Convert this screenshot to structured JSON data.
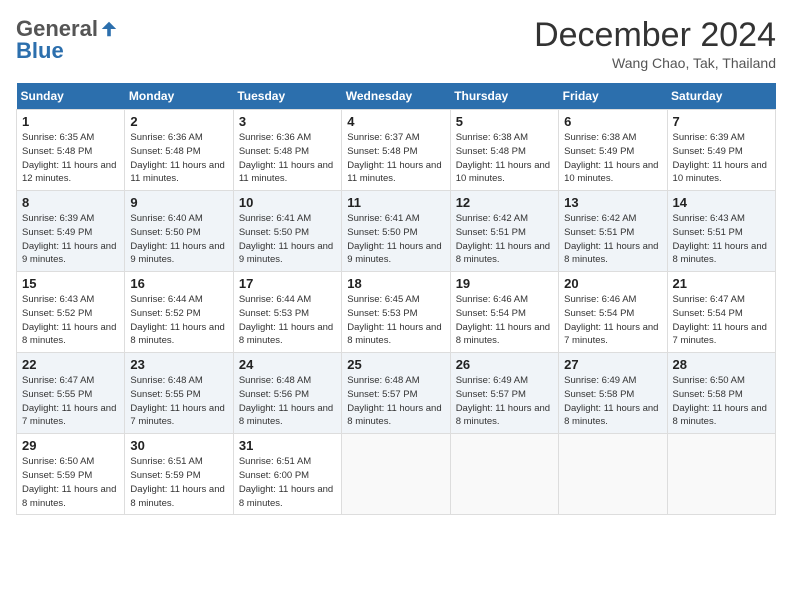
{
  "logo": {
    "general": "General",
    "blue": "Blue"
  },
  "title": "December 2024",
  "location": "Wang Chao, Tak, Thailand",
  "days_of_week": [
    "Sunday",
    "Monday",
    "Tuesday",
    "Wednesday",
    "Thursday",
    "Friday",
    "Saturday"
  ],
  "weeks": [
    [
      {
        "day": 1,
        "sunrise": "6:35 AM",
        "sunset": "5:48 PM",
        "daylight": "11 hours and 12 minutes."
      },
      {
        "day": 2,
        "sunrise": "6:36 AM",
        "sunset": "5:48 PM",
        "daylight": "11 hours and 11 minutes."
      },
      {
        "day": 3,
        "sunrise": "6:36 AM",
        "sunset": "5:48 PM",
        "daylight": "11 hours and 11 minutes."
      },
      {
        "day": 4,
        "sunrise": "6:37 AM",
        "sunset": "5:48 PM",
        "daylight": "11 hours and 11 minutes."
      },
      {
        "day": 5,
        "sunrise": "6:38 AM",
        "sunset": "5:48 PM",
        "daylight": "11 hours and 10 minutes."
      },
      {
        "day": 6,
        "sunrise": "6:38 AM",
        "sunset": "5:49 PM",
        "daylight": "11 hours and 10 minutes."
      },
      {
        "day": 7,
        "sunrise": "6:39 AM",
        "sunset": "5:49 PM",
        "daylight": "11 hours and 10 minutes."
      }
    ],
    [
      {
        "day": 8,
        "sunrise": "6:39 AM",
        "sunset": "5:49 PM",
        "daylight": "11 hours and 9 minutes."
      },
      {
        "day": 9,
        "sunrise": "6:40 AM",
        "sunset": "5:50 PM",
        "daylight": "11 hours and 9 minutes."
      },
      {
        "day": 10,
        "sunrise": "6:41 AM",
        "sunset": "5:50 PM",
        "daylight": "11 hours and 9 minutes."
      },
      {
        "day": 11,
        "sunrise": "6:41 AM",
        "sunset": "5:50 PM",
        "daylight": "11 hours and 9 minutes."
      },
      {
        "day": 12,
        "sunrise": "6:42 AM",
        "sunset": "5:51 PM",
        "daylight": "11 hours and 8 minutes."
      },
      {
        "day": 13,
        "sunrise": "6:42 AM",
        "sunset": "5:51 PM",
        "daylight": "11 hours and 8 minutes."
      },
      {
        "day": 14,
        "sunrise": "6:43 AM",
        "sunset": "5:51 PM",
        "daylight": "11 hours and 8 minutes."
      }
    ],
    [
      {
        "day": 15,
        "sunrise": "6:43 AM",
        "sunset": "5:52 PM",
        "daylight": "11 hours and 8 minutes."
      },
      {
        "day": 16,
        "sunrise": "6:44 AM",
        "sunset": "5:52 PM",
        "daylight": "11 hours and 8 minutes."
      },
      {
        "day": 17,
        "sunrise": "6:44 AM",
        "sunset": "5:53 PM",
        "daylight": "11 hours and 8 minutes."
      },
      {
        "day": 18,
        "sunrise": "6:45 AM",
        "sunset": "5:53 PM",
        "daylight": "11 hours and 8 minutes."
      },
      {
        "day": 19,
        "sunrise": "6:46 AM",
        "sunset": "5:54 PM",
        "daylight": "11 hours and 8 minutes."
      },
      {
        "day": 20,
        "sunrise": "6:46 AM",
        "sunset": "5:54 PM",
        "daylight": "11 hours and 7 minutes."
      },
      {
        "day": 21,
        "sunrise": "6:47 AM",
        "sunset": "5:54 PM",
        "daylight": "11 hours and 7 minutes."
      }
    ],
    [
      {
        "day": 22,
        "sunrise": "6:47 AM",
        "sunset": "5:55 PM",
        "daylight": "11 hours and 7 minutes."
      },
      {
        "day": 23,
        "sunrise": "6:48 AM",
        "sunset": "5:55 PM",
        "daylight": "11 hours and 7 minutes."
      },
      {
        "day": 24,
        "sunrise": "6:48 AM",
        "sunset": "5:56 PM",
        "daylight": "11 hours and 8 minutes."
      },
      {
        "day": 25,
        "sunrise": "6:48 AM",
        "sunset": "5:57 PM",
        "daylight": "11 hours and 8 minutes."
      },
      {
        "day": 26,
        "sunrise": "6:49 AM",
        "sunset": "5:57 PM",
        "daylight": "11 hours and 8 minutes."
      },
      {
        "day": 27,
        "sunrise": "6:49 AM",
        "sunset": "5:58 PM",
        "daylight": "11 hours and 8 minutes."
      },
      {
        "day": 28,
        "sunrise": "6:50 AM",
        "sunset": "5:58 PM",
        "daylight": "11 hours and 8 minutes."
      }
    ],
    [
      {
        "day": 29,
        "sunrise": "6:50 AM",
        "sunset": "5:59 PM",
        "daylight": "11 hours and 8 minutes."
      },
      {
        "day": 30,
        "sunrise": "6:51 AM",
        "sunset": "5:59 PM",
        "daylight": "11 hours and 8 minutes."
      },
      {
        "day": 31,
        "sunrise": "6:51 AM",
        "sunset": "6:00 PM",
        "daylight": "11 hours and 8 minutes."
      },
      null,
      null,
      null,
      null
    ]
  ]
}
